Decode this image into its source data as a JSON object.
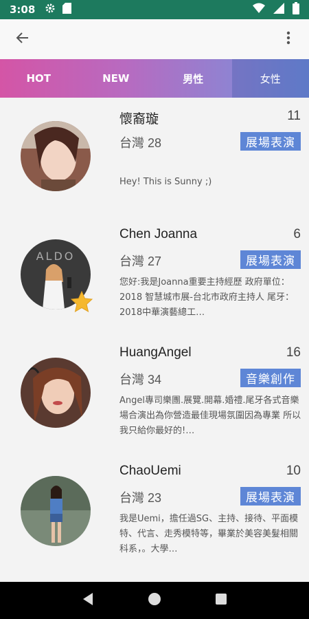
{
  "status_bar": {
    "time": "3:08",
    "icons": [
      "settings-icon",
      "sd-card-icon",
      "wifi-icon",
      "signal-icon",
      "battery-icon"
    ]
  },
  "app_bar": {
    "back_icon": "arrow-left-icon",
    "more_icon": "more-vert-icon"
  },
  "tabs": [
    {
      "label": "HOT",
      "active": false
    },
    {
      "label": "NEW",
      "active": false
    },
    {
      "label": "男性",
      "active": false
    },
    {
      "label": "女性",
      "active": true
    }
  ],
  "colors": {
    "status_bar": "#1d7a5e",
    "tab_gradient_start": "#d455a6",
    "tab_gradient_end": "#6c8bd8",
    "badge": "#5e86d6",
    "star": "#f5b82e"
  },
  "profiles": [
    {
      "name": "懷裔璇",
      "count": "11",
      "location": "台灣 28",
      "category": "展場表演",
      "description": "Hey! This is Sunny ;)",
      "featured": false
    },
    {
      "name": "Chen Joanna",
      "count": "6",
      "location": "台灣 27",
      "category": "展場表演",
      "description": "您好:我是Joanna重要主持經歷 政府單位： 2018 智慧城市展-台北市政府主持人 尾牙： 2018中華演藝總工…",
      "featured": true
    },
    {
      "name": "HuangAngel",
      "count": "16",
      "location": "台灣 34",
      "category": "音樂創作",
      "description": "Angel專司樂團.展覽.開幕.婚禮.尾牙各式音樂場合演出為你營造最佳現場氛圍因為專業 所以我只給你最好的!…",
      "featured": false
    },
    {
      "name": "ChaoUemi",
      "count": "10",
      "location": "台灣 23",
      "category": "展場表演",
      "description": "我是Uemi，擔任過SG、主持、接待、平面模特、代言、走秀模特等，畢業於美容美髮相關科系，。大學…",
      "featured": false
    }
  ],
  "nav_bar": {
    "icons": [
      "back-triangle-icon",
      "home-circle-icon",
      "recents-square-icon"
    ]
  }
}
